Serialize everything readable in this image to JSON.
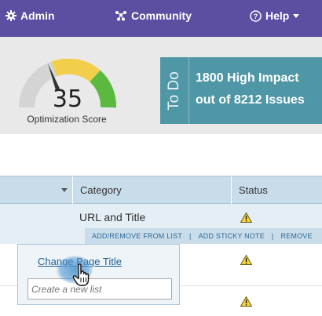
{
  "nav": {
    "admin_label": "Admin",
    "community_label": "Community",
    "help_label": "Help"
  },
  "score": {
    "value": "35",
    "label": "Optimization Score",
    "gauge_level": 0.35,
    "gauge_colors": [
      "#d4d4d4",
      "#f2cf4b",
      "#5cb940"
    ]
  },
  "todo": {
    "tab_label": "To Do",
    "line1": "1800 High Impact",
    "line2": "out of 8212 Issues"
  },
  "table": {
    "columns": [
      "Category",
      "Status"
    ],
    "rows": [
      {
        "category": "URL and Title",
        "status_icon": "warning-icon"
      }
    ],
    "row_actions": [
      "ADD/REMOVE FROM LIST",
      "ADD STICKY NOTE",
      "REMOVE"
    ],
    "action_separator": "|"
  },
  "popup": {
    "link_label": "Change Page Title",
    "input_placeholder": "Create a new list"
  },
  "colors": {
    "nav_bg": "#5c4ea1",
    "todo_bg": "#4f97a7",
    "header_bg": "#c9dcea",
    "link": "#1f5f93"
  }
}
